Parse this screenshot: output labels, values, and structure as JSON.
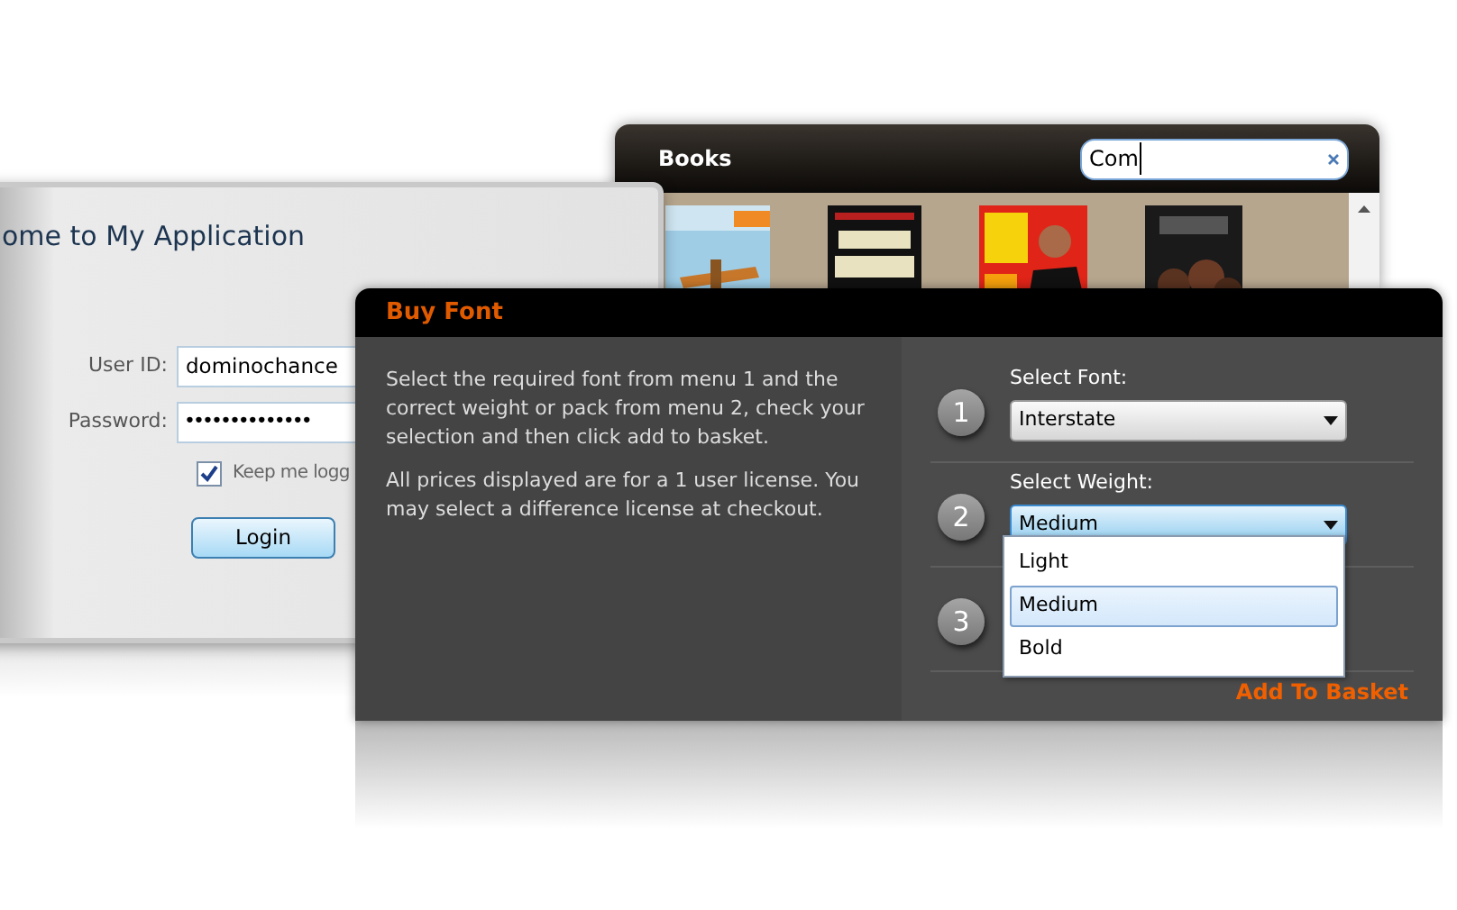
{
  "books_window": {
    "title": "Books",
    "search": {
      "value": "Com"
    }
  },
  "login_window": {
    "title": "ome to My Application",
    "user_id": {
      "label": "User ID:",
      "value": "dominochance"
    },
    "password": {
      "label": "Password:",
      "value": "••••••••••••••"
    },
    "keep_logged_in": {
      "label": "Keep me logg",
      "checked": true
    },
    "login_button": "Login"
  },
  "buy_font": {
    "title": "Buy Font",
    "paragraphs": [
      "Select the required font from menu 1 and the correct weight or pack from menu 2, check your selection and then click add to basket.",
      "All prices displayed are for a 1 user license. You may select a difference license at checkout."
    ],
    "steps": [
      {
        "number": "1",
        "label": "Select Font:",
        "value": "Interstate",
        "expanded": false
      },
      {
        "number": "2",
        "label": "Select Weight:",
        "value": "Medium",
        "expanded": true,
        "options": [
          {
            "label": "Light",
            "selected": false
          },
          {
            "label": "Medium",
            "selected": true
          },
          {
            "label": "Bold",
            "selected": false
          }
        ]
      },
      {
        "number": "3"
      }
    ],
    "add_button": "Add To Basket"
  }
}
